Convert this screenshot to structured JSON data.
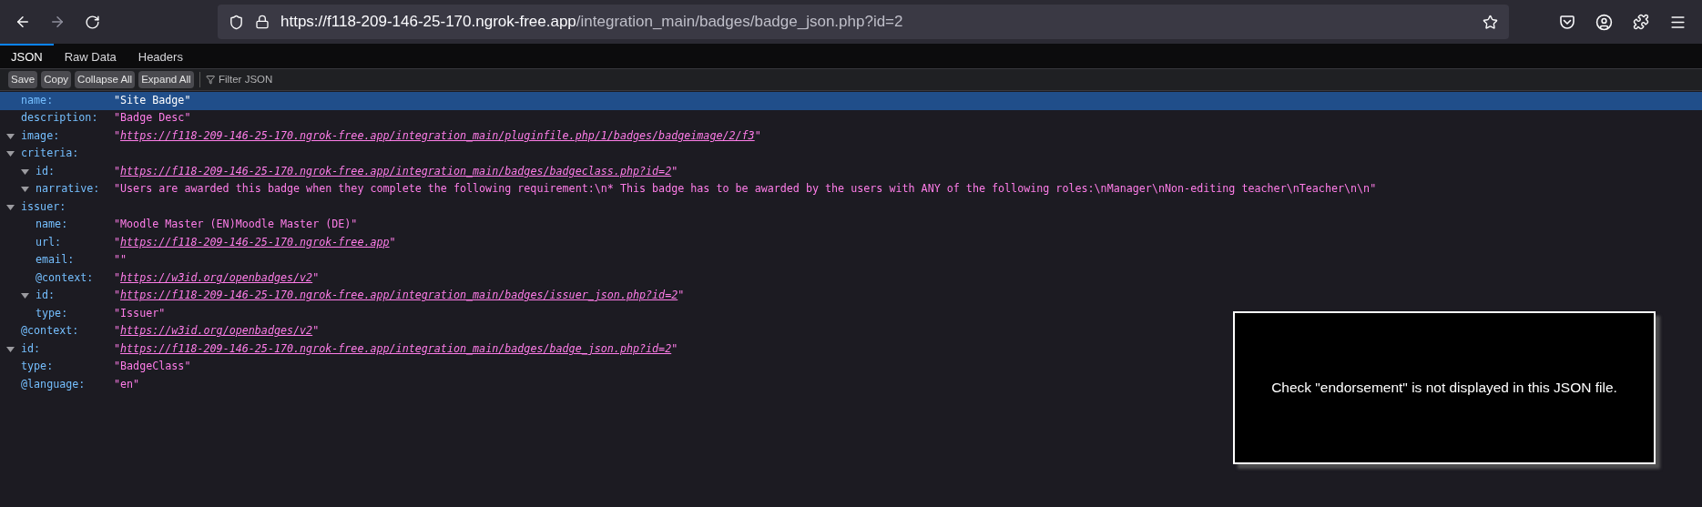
{
  "browser": {
    "url_host": "https://f118-209-146-25-170.ngrok-free.app",
    "url_path": "/integration_main/badges/badge_json.php?id=2"
  },
  "tabs": [
    {
      "label": "JSON",
      "selected": true
    },
    {
      "label": "Raw Data",
      "selected": false
    },
    {
      "label": "Headers",
      "selected": false
    }
  ],
  "toolbar": {
    "buttons": [
      "Save",
      "Copy",
      "Collapse All",
      "Expand All"
    ],
    "filter": {
      "placeholder": "Filter JSON"
    }
  },
  "tree": [
    {
      "key": "name:",
      "value": "\"Site Badge\"",
      "selected": true
    },
    {
      "key": "description:",
      "value": "\"Badge Desc\"",
      "selected": false
    },
    {
      "key": "image:",
      "value": "\"*https://f118-209-146-25-170.ngrok-free.app/integration_main/pluginfile.php/1/badges/badgeimage/2/f3*\"",
      "selected": false,
      "expanded": true
    },
    {
      "key": "criteria:",
      "selected": false,
      "expanded": true,
      "children": [
        {
          "key": "id:",
          "value": "\"*https://f118-209-146-25-170.ngrok-free.app/integration_main/badges/badgeclass.php?id=2*\"",
          "selected": false,
          "expanded": true
        },
        {
          "key": "narrative:",
          "value": "\"Users are awarded this badge when they complete the following requirement:\\n* This badge has to be awarded by the users with ANY of the following roles:\\nManager\\nNon-editing teacher\\nTeacher\\n\\n\"",
          "selected": false,
          "expanded": true
        }
      ]
    },
    {
      "key": "issuer:",
      "selected": false,
      "expanded": true,
      "children": [
        {
          "key": "name:",
          "value": "\"Moodle Master (EN)Moodle Master (DE)\"",
          "selected": false
        },
        {
          "key": "url:",
          "value": "\"*https://f118-209-146-25-170.ngrok-free.app*\"",
          "selected": false
        },
        {
          "key": "email:",
          "value": "\"\"",
          "selected": false
        },
        {
          "key": "@context:",
          "value": "\"*https://w3id.org/openbadges/v2*\"",
          "selected": false
        },
        {
          "key": "id:",
          "value": "\"*https://f118-209-146-25-170.ngrok-free.app/integration_main/badges/issuer_json.php?id=2*\"",
          "selected": false,
          "expanded": true
        },
        {
          "key": "type:",
          "value": "\"Issuer\"",
          "selected": false
        }
      ]
    },
    {
      "key": "@context:",
      "value": "\"*https://w3id.org/openbadges/v2*\"",
      "selected": false
    },
    {
      "key": "id:",
      "value": "\"*https://f118-209-146-25-170.ngrok-free.app/integration_main/badges/badge_json.php?id=2*\"",
      "selected": false,
      "expanded": true
    },
    {
      "key": "type:",
      "value": "\"BadgeClass\"",
      "selected": false
    },
    {
      "key": "@language:",
      "value": "\"en\"",
      "selected": false
    }
  ],
  "overlay": {
    "message": "Check \"endorsement\" is not displayed in this JSON file."
  }
}
